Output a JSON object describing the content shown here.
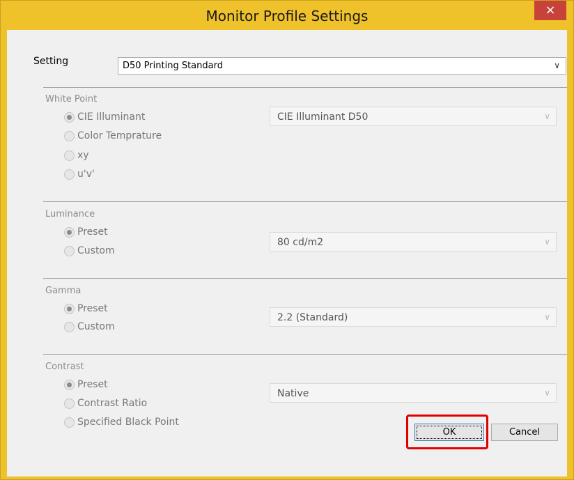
{
  "window": {
    "title": "Monitor Profile Settings",
    "close_glyph": "×"
  },
  "setting": {
    "label": "Setting",
    "value": "D50 Printing Standard"
  },
  "white_point": {
    "title": "White Point",
    "options": [
      "CIE Illuminant",
      "Color Temprature",
      "xy",
      "u'v'"
    ],
    "selected": "CIE Illuminant",
    "dropdown_value": "CIE Illuminant D50"
  },
  "luminance": {
    "title": "Luminance",
    "options": [
      "Preset",
      "Custom"
    ],
    "selected": "Preset",
    "dropdown_value": "80 cd/m2"
  },
  "gamma": {
    "title": "Gamma",
    "options": [
      "Preset",
      "Custom"
    ],
    "selected": "Preset",
    "dropdown_value": "2.2 (Standard)"
  },
  "contrast": {
    "title": "Contrast",
    "options": [
      "Preset",
      "Contrast Ratio",
      "Specified Black Point"
    ],
    "selected": "Preset",
    "dropdown_value": "Native"
  },
  "buttons": {
    "ok": "OK",
    "cancel": "Cancel"
  },
  "colors": {
    "title_bar": "#efc12a",
    "close_button": "#c7433a",
    "highlight": "#e00000"
  },
  "icons": {
    "dropdown": "chevron-down-icon",
    "close": "close-icon"
  }
}
